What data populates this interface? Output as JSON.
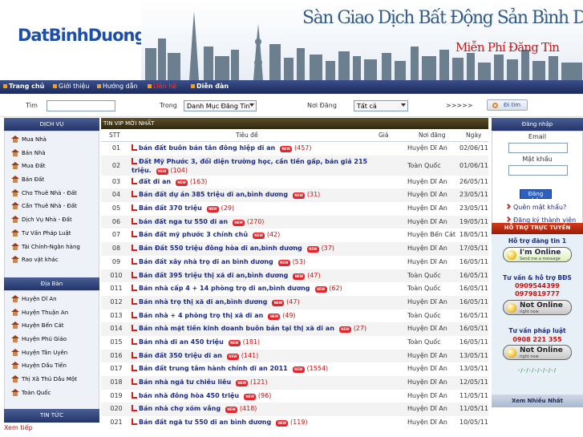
{
  "banner": {
    "logo": "DatBinhDuong.Net",
    "title": "Sàn Giao Dịch Bất Động Sản Bình Dương",
    "slogan": "Miễn Phí Đăng Tin"
  },
  "nav": {
    "items": [
      "Trang chủ",
      "Giới thiệu",
      "Hướng dẫn",
      "Liên hệ",
      "Diễn đàn"
    ]
  },
  "search": {
    "label": "Tìm",
    "input_value": "",
    "in_label": "Trong",
    "category_select": "Danh Mục Đăng Tin",
    "place_label": "Nơi Đăng",
    "place_select": "Tất cả",
    "arrows": ">>>>>",
    "button": "Đi tìm"
  },
  "left": {
    "dichvu_title": "DỊCH VỤ",
    "dichvu": [
      "Mua Nhà",
      "Bán Nhà",
      "Mua Đất",
      "Bán Đất",
      "Cho Thuê Nhà - Đất",
      "Cần Thuê Nhà - Đất",
      "Dịch Vụ Nhà - Đất",
      "Tư Vấn Pháp Luật",
      "Tài Chính-Ngân hàng",
      "Rao vặt khác"
    ],
    "diaban_title": "Địa Bàn",
    "diaban": [
      "Huyện Dĩ An",
      "Huyện Thuận An",
      "Huyện Bến Cát",
      "Huyện Phú Giáo",
      "Huyện Tân Uyên",
      "Huyện Dầu Tiến",
      "Thị Xã Thủ Dầu Một",
      "Toàn Quốc"
    ],
    "tintuc_title": "TIN TỨC",
    "tintuc_link": "Xem tiếp"
  },
  "main": {
    "section_title": "TIN VIP MỚI NHẤT",
    "columns": {
      "stt": "STT",
      "title": "Tiêu đề",
      "price": "Giá",
      "place": "Nơi đăng",
      "date": "Ngày"
    },
    "new_badge": "NEW",
    "rows": [
      {
        "stt": "01",
        "title": "bán đất buôn bán tân đông hiệp dĩ an",
        "views": "(457)",
        "place": "Huyện Dĩ An",
        "date": "02/06/11"
      },
      {
        "stt": "02",
        "title": "Đất Mỹ Phước 3, đối diện trường học, cần tiền gấp, bán giá 215 triệu.",
        "views": "(104)",
        "place": "Toàn Quốc",
        "date": "01/06/11"
      },
      {
        "stt": "03",
        "title": "đất dĩ an",
        "views": "(163)",
        "place": "Huyện Dĩ An",
        "date": "26/05/11"
      },
      {
        "stt": "04",
        "title": "Bán đất dự án 385 triệu dĩ an,bình dương",
        "views": "(31)",
        "place": "Huyện Dĩ An",
        "date": "23/05/11"
      },
      {
        "stt": "05",
        "title": "Bán đất 370 triệu",
        "views": "(29)",
        "place": "Huyện Dĩ An",
        "date": "23/05/11"
      },
      {
        "stt": "06",
        "title": "bán đất nga tư 550 dĩ an",
        "views": "(270)",
        "place": "Huyện Dĩ An",
        "date": "19/05/11"
      },
      {
        "stt": "07",
        "title": "Bán đất mỹ phước 3 chính chủ",
        "views": "(42)",
        "place": "Huyện Bến Cát",
        "date": "18/05/11"
      },
      {
        "stt": "08",
        "title": "Bán Đất 550 triệu đông hòa dĩ an,bình dương",
        "views": "(37)",
        "place": "Huyện Dĩ An",
        "date": "17/05/11"
      },
      {
        "stt": "09",
        "title": "Bán đất xây nhà trọ dĩ an bình dương",
        "views": "(53)",
        "place": "Huyện Dĩ An",
        "date": "16/05/11"
      },
      {
        "stt": "010",
        "title": "Bán đất 395 triệu thị xã dĩ an,bình dương",
        "views": "(47)",
        "place": "Toàn Quốc",
        "date": "16/05/11"
      },
      {
        "stt": "011",
        "title": "Bán nhà cấp 4 + 14 phòng trọ dĩ an,bình dương",
        "views": "(62)",
        "place": "Toàn Quốc",
        "date": "16/05/11"
      },
      {
        "stt": "012",
        "title": "Bán nhà trọ thị xã dĩ an,bình dương",
        "views": "(47)",
        "place": "Huyện Dĩ An",
        "date": "16/05/11"
      },
      {
        "stt": "013",
        "title": "Bán nhà + 4 phòng trọ thị xã dĩ an",
        "views": "(49)",
        "place": "Toàn Quốc",
        "date": "16/05/11"
      },
      {
        "stt": "014",
        "title": "Bán nhà mặt tiền kinh doanh buôn bán tại thị xã dĩ an",
        "views": "(27)",
        "place": "Huyện Dĩ An",
        "date": "16/05/11"
      },
      {
        "stt": "015",
        "title": "Bán nhà dĩ an 450 triệu",
        "views": "(181)",
        "place": "Toàn Quốc",
        "date": "16/05/11"
      },
      {
        "stt": "016",
        "title": "Bán đất 350 triệu dĩ an",
        "views": "(141)",
        "place": "Huyện Dĩ An",
        "date": "13/05/11"
      },
      {
        "stt": "017",
        "title": "Bán đất trung tâm hành chính dĩ an 2011",
        "views": "(1554)",
        "place": "Huyện Dĩ An",
        "date": "13/05/11"
      },
      {
        "stt": "018",
        "title": "Bán nhà ngã tư chiêu liêu",
        "views": "(121)",
        "place": "Huyện Dĩ An",
        "date": "12/05/11"
      },
      {
        "stt": "019",
        "title": "bán nhà đông hòa 450 triệu",
        "views": "(96)",
        "place": "Huyện Dĩ An",
        "date": "11/05/11"
      },
      {
        "stt": "020",
        "title": "Bán nhà chợ xóm vắng",
        "views": "(418)",
        "place": "Huyện Dĩ An",
        "date": "11/05/11"
      },
      {
        "stt": "021",
        "title": "Bán đất ngã tư 550 dĩ an bình dương",
        "views": "(119)",
        "place": "Huyện Dĩ An",
        "date": "10/05/11"
      }
    ]
  },
  "right": {
    "login_title": "Đăng nhập",
    "email_label": "Email",
    "password_label": "Mật khẩu",
    "login_button": "Đăng nhập",
    "forgot": "Quên mật khẩu?",
    "register": "Đăng ký thành viên",
    "support_title": "HỖ TRỢ TRỰC TUYẾN",
    "support1": "Hỗ trợ đăng tin 1",
    "online_l1": "I'm Online",
    "online_l2": "Send me a message",
    "support2": "Tư vấn & hỗ trợ BĐS",
    "phone1": "0909544399",
    "phone2": "0979819777",
    "offline_l1": "Not Online",
    "offline_l2": "right now",
    "support3": "Tư vấn pháp luật",
    "phone3": "0908 221 355",
    "dashes": "-/-/-/-/-/-/-/",
    "xem_title": "Xem Nhiều Nhất"
  },
  "colors": {
    "nav": "#1d2a5c",
    "accent_red": "#cc1111",
    "link_blue": "#1d2c8c",
    "support_head": "#d43b1a"
  }
}
